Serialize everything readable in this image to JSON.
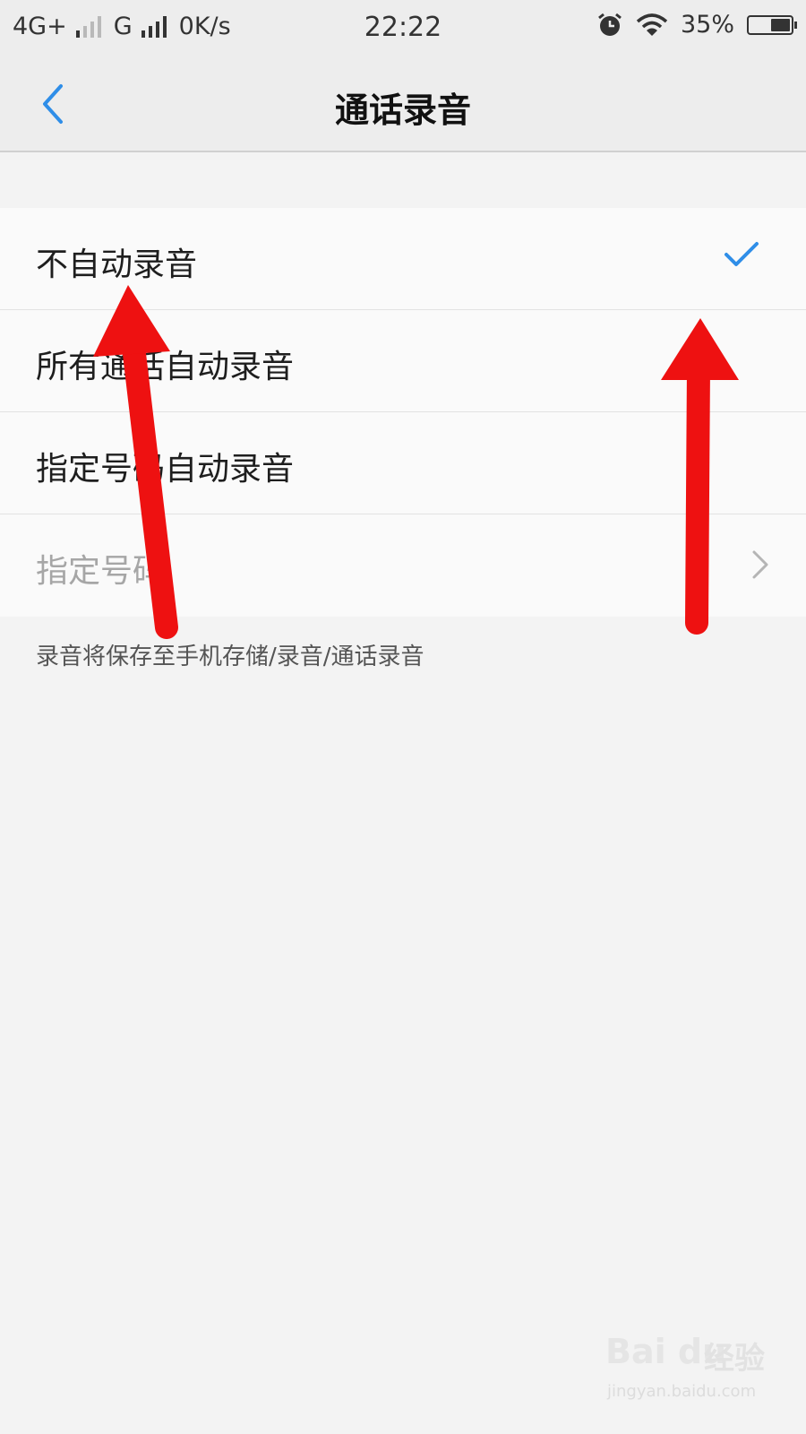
{
  "status_bar": {
    "network1": "4G+",
    "network2": "G",
    "speed": "0K/s",
    "time": "22:22",
    "battery_text": "35%",
    "battery_level": 0.35,
    "icons": [
      "signal-bars-icon",
      "alarm-clock-icon",
      "wifi-icon",
      "battery-icon"
    ]
  },
  "header": {
    "title": "通话录音",
    "back_icon": "chevron-left-icon"
  },
  "options": [
    {
      "label": "不自动录音",
      "selected": true
    },
    {
      "label": "所有通话自动录音",
      "selected": false
    },
    {
      "label": "指定号码自动录音",
      "selected": false
    },
    {
      "label": "指定号码",
      "disabled": true,
      "has_chevron": true
    }
  ],
  "note": "录音将保存至手机存储/录音/通话录音",
  "annotations": {
    "arrow_color": "#ee1111",
    "count": 2
  },
  "watermark": {
    "logo": "Bai du",
    "cn": "经验",
    "url": "jingyan.baidu.com"
  },
  "colors": {
    "accent": "#2f8ee8",
    "background": "#f3f3f3",
    "row_bg": "#fafafa"
  }
}
